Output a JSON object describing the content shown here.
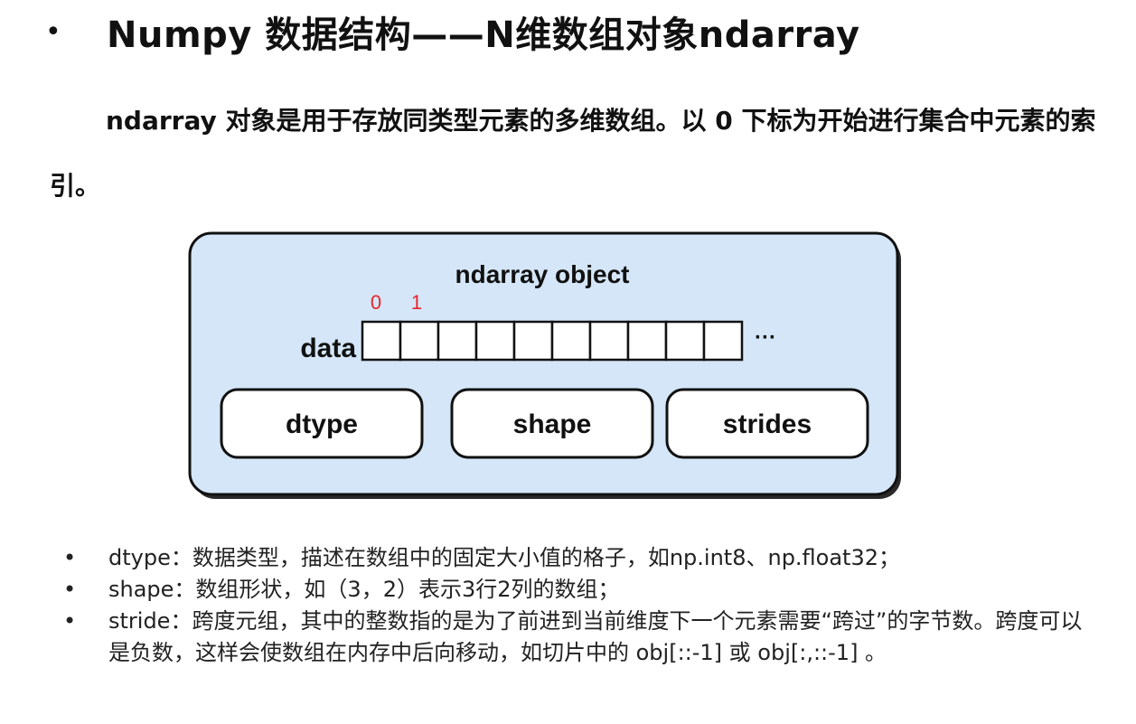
{
  "slide": {
    "bullet": "•",
    "title": "Numpy 数据结构——N维数组对象ndarray",
    "intro": "ndarray 对象是用于存放同类型元素的多维数组。以 0 下标为开始进行集合中元素的索引。"
  },
  "diagram": {
    "heading": "ndarray object",
    "data_label": "data",
    "ellipsis": "···",
    "index_labels": [
      "0",
      "1"
    ],
    "cell_count": 10,
    "boxes": [
      "dtype",
      "shape",
      "strides"
    ],
    "colors": {
      "panel_fill": "#d4e6f7",
      "panel_stroke": "#111111",
      "index_red": "#e8262a"
    }
  },
  "bullets": [
    "dtype：数据类型，描述在数组中的固定大小值的格子，如np.int8、np.float32；",
    "shape：数组形状，如（3，2）表示3行2列的数组；",
    "stride：跨度元组，其中的整数指的是为了前进到当前维度下一个元素需要“跨过”的字节数。跨度可以是负数，这样会使数组在内存中后向移动，如切片中的 obj[::-1] 或 obj[:,::-1] 。"
  ]
}
